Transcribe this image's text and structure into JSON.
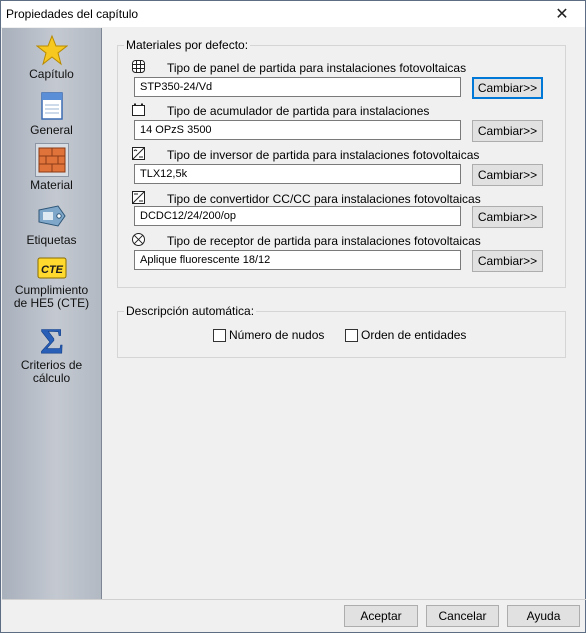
{
  "window": {
    "title": "Propiedades del capítulo",
    "close_glyph": "✕"
  },
  "sidebar": {
    "items": [
      {
        "label": "Capítulo",
        "icon": "star-icon"
      },
      {
        "label": "General",
        "icon": "notebook-icon"
      },
      {
        "label": "Material",
        "icon": "brick-icon",
        "selected": true
      },
      {
        "label": "Etiquetas",
        "icon": "tag-icon"
      },
      {
        "label": "Cumplimiento de HE5 (CTE)",
        "icon": "cte-badge-icon",
        "badge_text": "CTE"
      },
      {
        "label": "Criterios de cálculo",
        "icon": "sigma-icon",
        "glyph": "Σ"
      }
    ]
  },
  "materials": {
    "group_label": "Materiales por defecto:",
    "rows": [
      {
        "label": "Tipo de panel de partida para instalaciones fotovoltaicas",
        "value": "STP350-24/Vd",
        "button": "Cambiar>>",
        "icon": "solar-panel-icon"
      },
      {
        "label": "Tipo de acumulador de partida para instalaciones",
        "value": "14 OPzS 3500",
        "button": "Cambiar>>",
        "icon": "battery-icon"
      },
      {
        "label": "Tipo de inversor de partida para instalaciones fotovoltaicas",
        "value": "TLX12,5k",
        "button": "Cambiar>>",
        "icon": "inverter-icon"
      },
      {
        "label": "Tipo de convertidor CC/CC para instalaciones fotovoltaicas",
        "value": "DCDC12/24/200/op",
        "button": "Cambiar>>",
        "icon": "converter-icon"
      },
      {
        "label": "Tipo de receptor de partida para instalaciones fotovoltaicas",
        "value": "Aplique fluorescente 18/12",
        "button": "Cambiar>>",
        "icon": "lamp-receptor-icon"
      }
    ]
  },
  "description": {
    "group_label": "Descripción automática:",
    "checkbox_nodes": {
      "label": "Número de nudos",
      "checked": false
    },
    "checkbox_entities": {
      "label": "Orden de entidades",
      "checked": false
    }
  },
  "footer": {
    "accept": "Aceptar",
    "cancel": "Cancelar",
    "help": "Ayuda"
  }
}
